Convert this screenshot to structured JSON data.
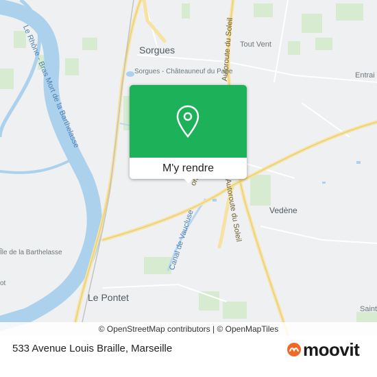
{
  "popup": {
    "action_label": "M'y rendre",
    "pin_icon": "location-pin-icon",
    "color": "#1db15a"
  },
  "map": {
    "towns": {
      "sorgues": "Sorgues",
      "sorgues_chateauneuf": "Sorgues - Châteauneuf du Pape",
      "tout_vent": "Tout Vent",
      "entraigues": "Entrai sur-la-S",
      "vedene": "Vedène",
      "le_pontet": "Le Pontet",
      "saint": "Saint",
      "ile_barthelasse": "Île de la Barthelasse",
      "partial_ot": "ot",
      "partial_on": "on"
    },
    "roads": {
      "autoroute_north": "Autoroute du Soleil",
      "autoroute_south": "Autoroute du Soleil",
      "canal": "Canal de Vaucluse"
    },
    "water": {
      "rhone": "Le Rhône - Bras Mort de la Barthelasse"
    }
  },
  "attribution": "© OpenStreetMap contributors | © OpenMapTiles",
  "footer": {
    "address": "533 Avenue Louis Braille, Marseille",
    "brand": "moovit",
    "brand_color": "#f26722",
    "brand_icon": "moovit-logo-icon"
  }
}
